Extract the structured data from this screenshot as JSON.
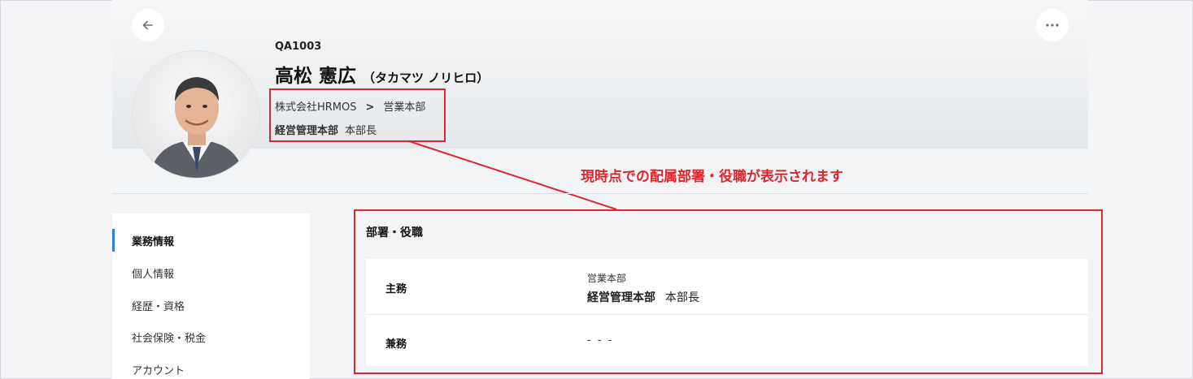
{
  "profile": {
    "employee_code": "QA1003",
    "name": "高松 憲広",
    "name_kana": "（タカマツ ノリヒロ）",
    "company": "株式会社HRMOS",
    "chevron": ">",
    "division": "営業本部",
    "department": "経営管理本部",
    "position": "本部長"
  },
  "annotation": {
    "text": "現時点での配属部署・役職が表示されます",
    "color": "#e0262c"
  },
  "sidebar": {
    "items": [
      {
        "label": "業務情報",
        "active": true
      },
      {
        "label": "個人情報",
        "active": false
      },
      {
        "label": "経歴・資格",
        "active": false
      },
      {
        "label": "社会保険・税金",
        "active": false
      },
      {
        "label": "アカウント",
        "active": false
      }
    ]
  },
  "section": {
    "title": "部署・役職",
    "main_label": "主務",
    "main_division": "営業本部",
    "main_department": "経営管理本部",
    "main_position": "本部長",
    "side_label": "兼務",
    "side_value": "- - -"
  },
  "icons": {
    "back": "arrow-left-icon",
    "more": "more-horizontal-icon"
  }
}
